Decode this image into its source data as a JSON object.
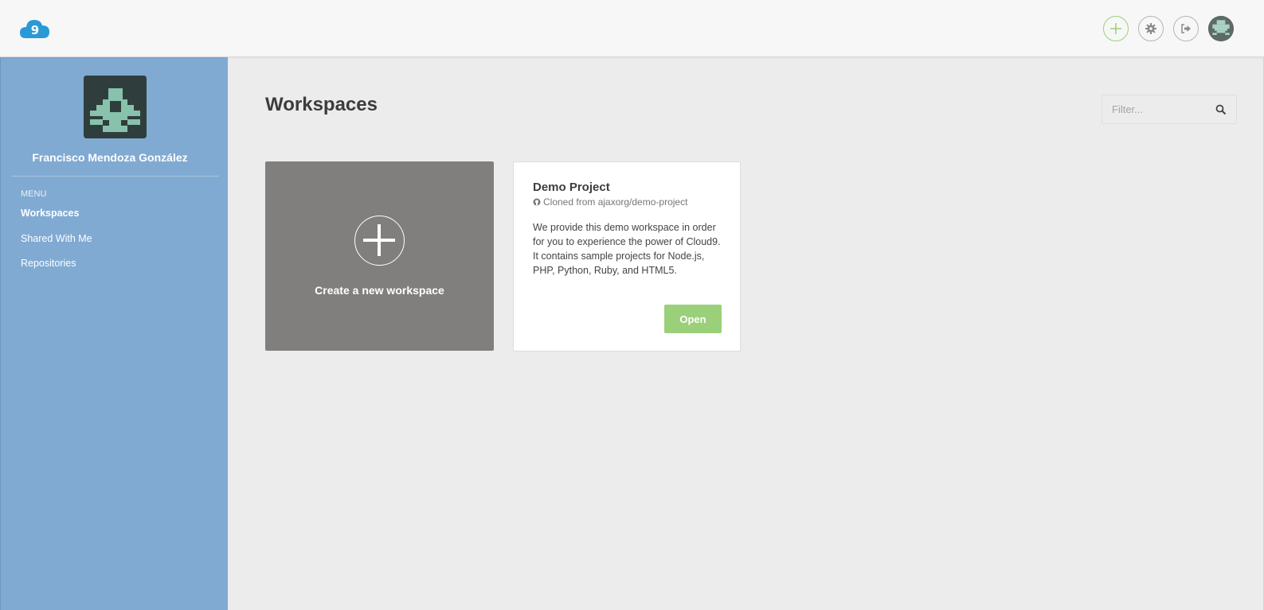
{
  "header": {
    "logo_icon": "cloud9-logo-icon",
    "actions": [
      {
        "name": "create-workspace-button",
        "icon": "plus-icon",
        "color": "#9bd07a"
      },
      {
        "name": "settings-button",
        "icon": "gear-icon"
      },
      {
        "name": "logout-button",
        "icon": "sign-out-icon"
      },
      {
        "name": "user-avatar-button",
        "icon": "avatar-icon"
      }
    ]
  },
  "sidebar": {
    "user_name": "Francisco Mendoza González",
    "menu_heading": "MENU",
    "items": [
      {
        "label": "Workspaces",
        "active": true
      },
      {
        "label": "Shared With Me",
        "active": false
      },
      {
        "label": "Repositories",
        "active": false
      }
    ]
  },
  "main": {
    "title": "Workspaces",
    "filter_placeholder": "Filter...",
    "create_card_label": "Create a new workspace",
    "workspaces": [
      {
        "title": "Demo Project",
        "source": "Cloned from ajaxorg/demo-project",
        "source_icon": "github-icon",
        "description": "We provide this demo workspace in order for you to experience the power of Cloud9. It contains sample projects for Node.js, PHP, Python, Ruby, and HTML5.",
        "open_label": "Open"
      }
    ]
  },
  "colors": {
    "sidebar_bg": "#80aad2",
    "accent_green": "#9bd07a",
    "create_card_bg": "#807f7d",
    "avatar_dark": "#2f3e3c",
    "avatar_light": "#88c2ad"
  }
}
